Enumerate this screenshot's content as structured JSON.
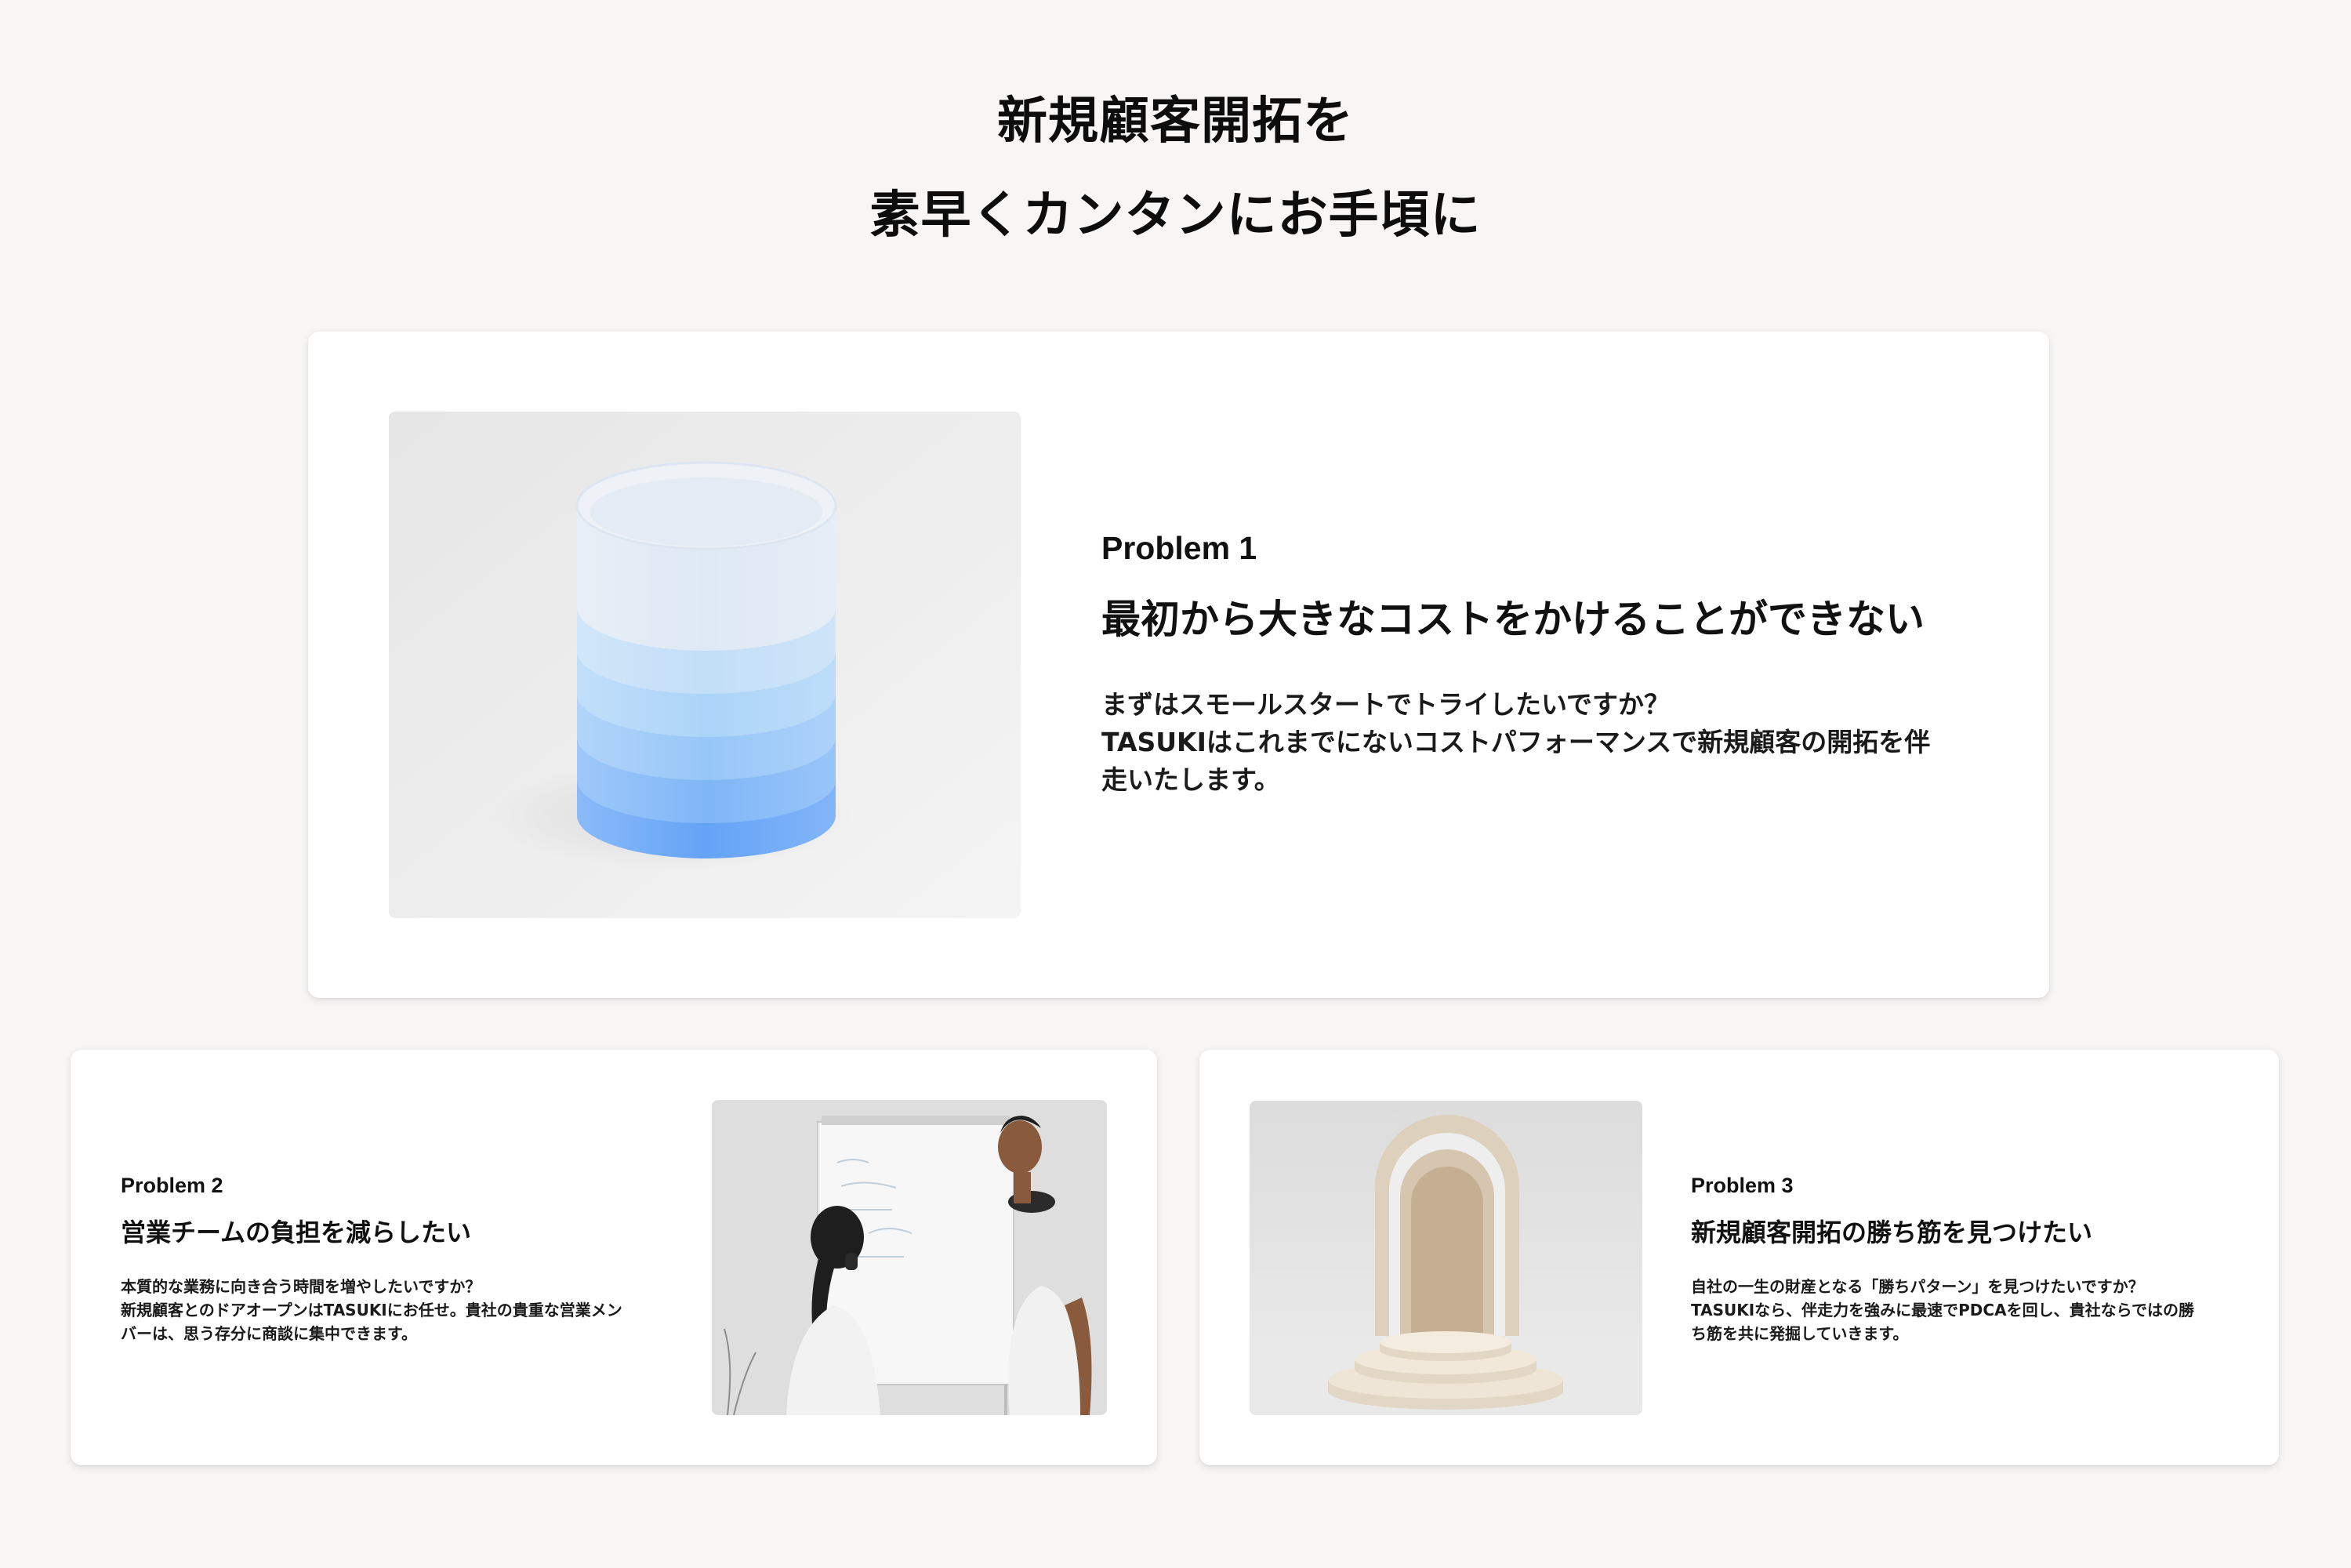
{
  "headline": {
    "line1": "新規顧客開拓を",
    "line2": "素早くカンタンにお手頃に"
  },
  "problems": [
    {
      "label": "Problem 1",
      "title": "最初から大きなコストをかけることができない",
      "body_lines": [
        "まずはスモールスタートでトライしたいですか？",
        "TASUKIはこれまでにないコストパフォーマンスで新規顧客の開拓を伴",
        "走いたします。"
      ],
      "image": "stacked-blue-cylinder-photo"
    },
    {
      "label": "Problem 2",
      "title": "営業チームの負担を減らしたい",
      "body_lines": [
        "本質的な業務に向き合う時間を増やしたいですか？",
        "新規顧客とのドアオープンはTASUKIにお任せ。貴社の貴重な営業メン",
        "バーは、思う存分に商談に集中できます。"
      ],
      "image": "whiteboard-meeting-photo"
    },
    {
      "label": "Problem 3",
      "title": "新規顧客開拓の勝ち筋を見つけたい",
      "body_lines": [
        "自社の一生の財産となる「勝ちパターン」を見つけたいですか？",
        "TASUKIなら、伴走力を強みに最速でPDCAを回し、貴社ならではの勝",
        "ち筋を共に発掘していきます。"
      ],
      "image": "arch-podium-photo"
    }
  ],
  "colors": {
    "background": "#f7f6f5",
    "card": "#ffffff",
    "text": "#111111",
    "cylinder_top": "#e3edf7",
    "cylinder_bottom": "#5c9cf5"
  }
}
